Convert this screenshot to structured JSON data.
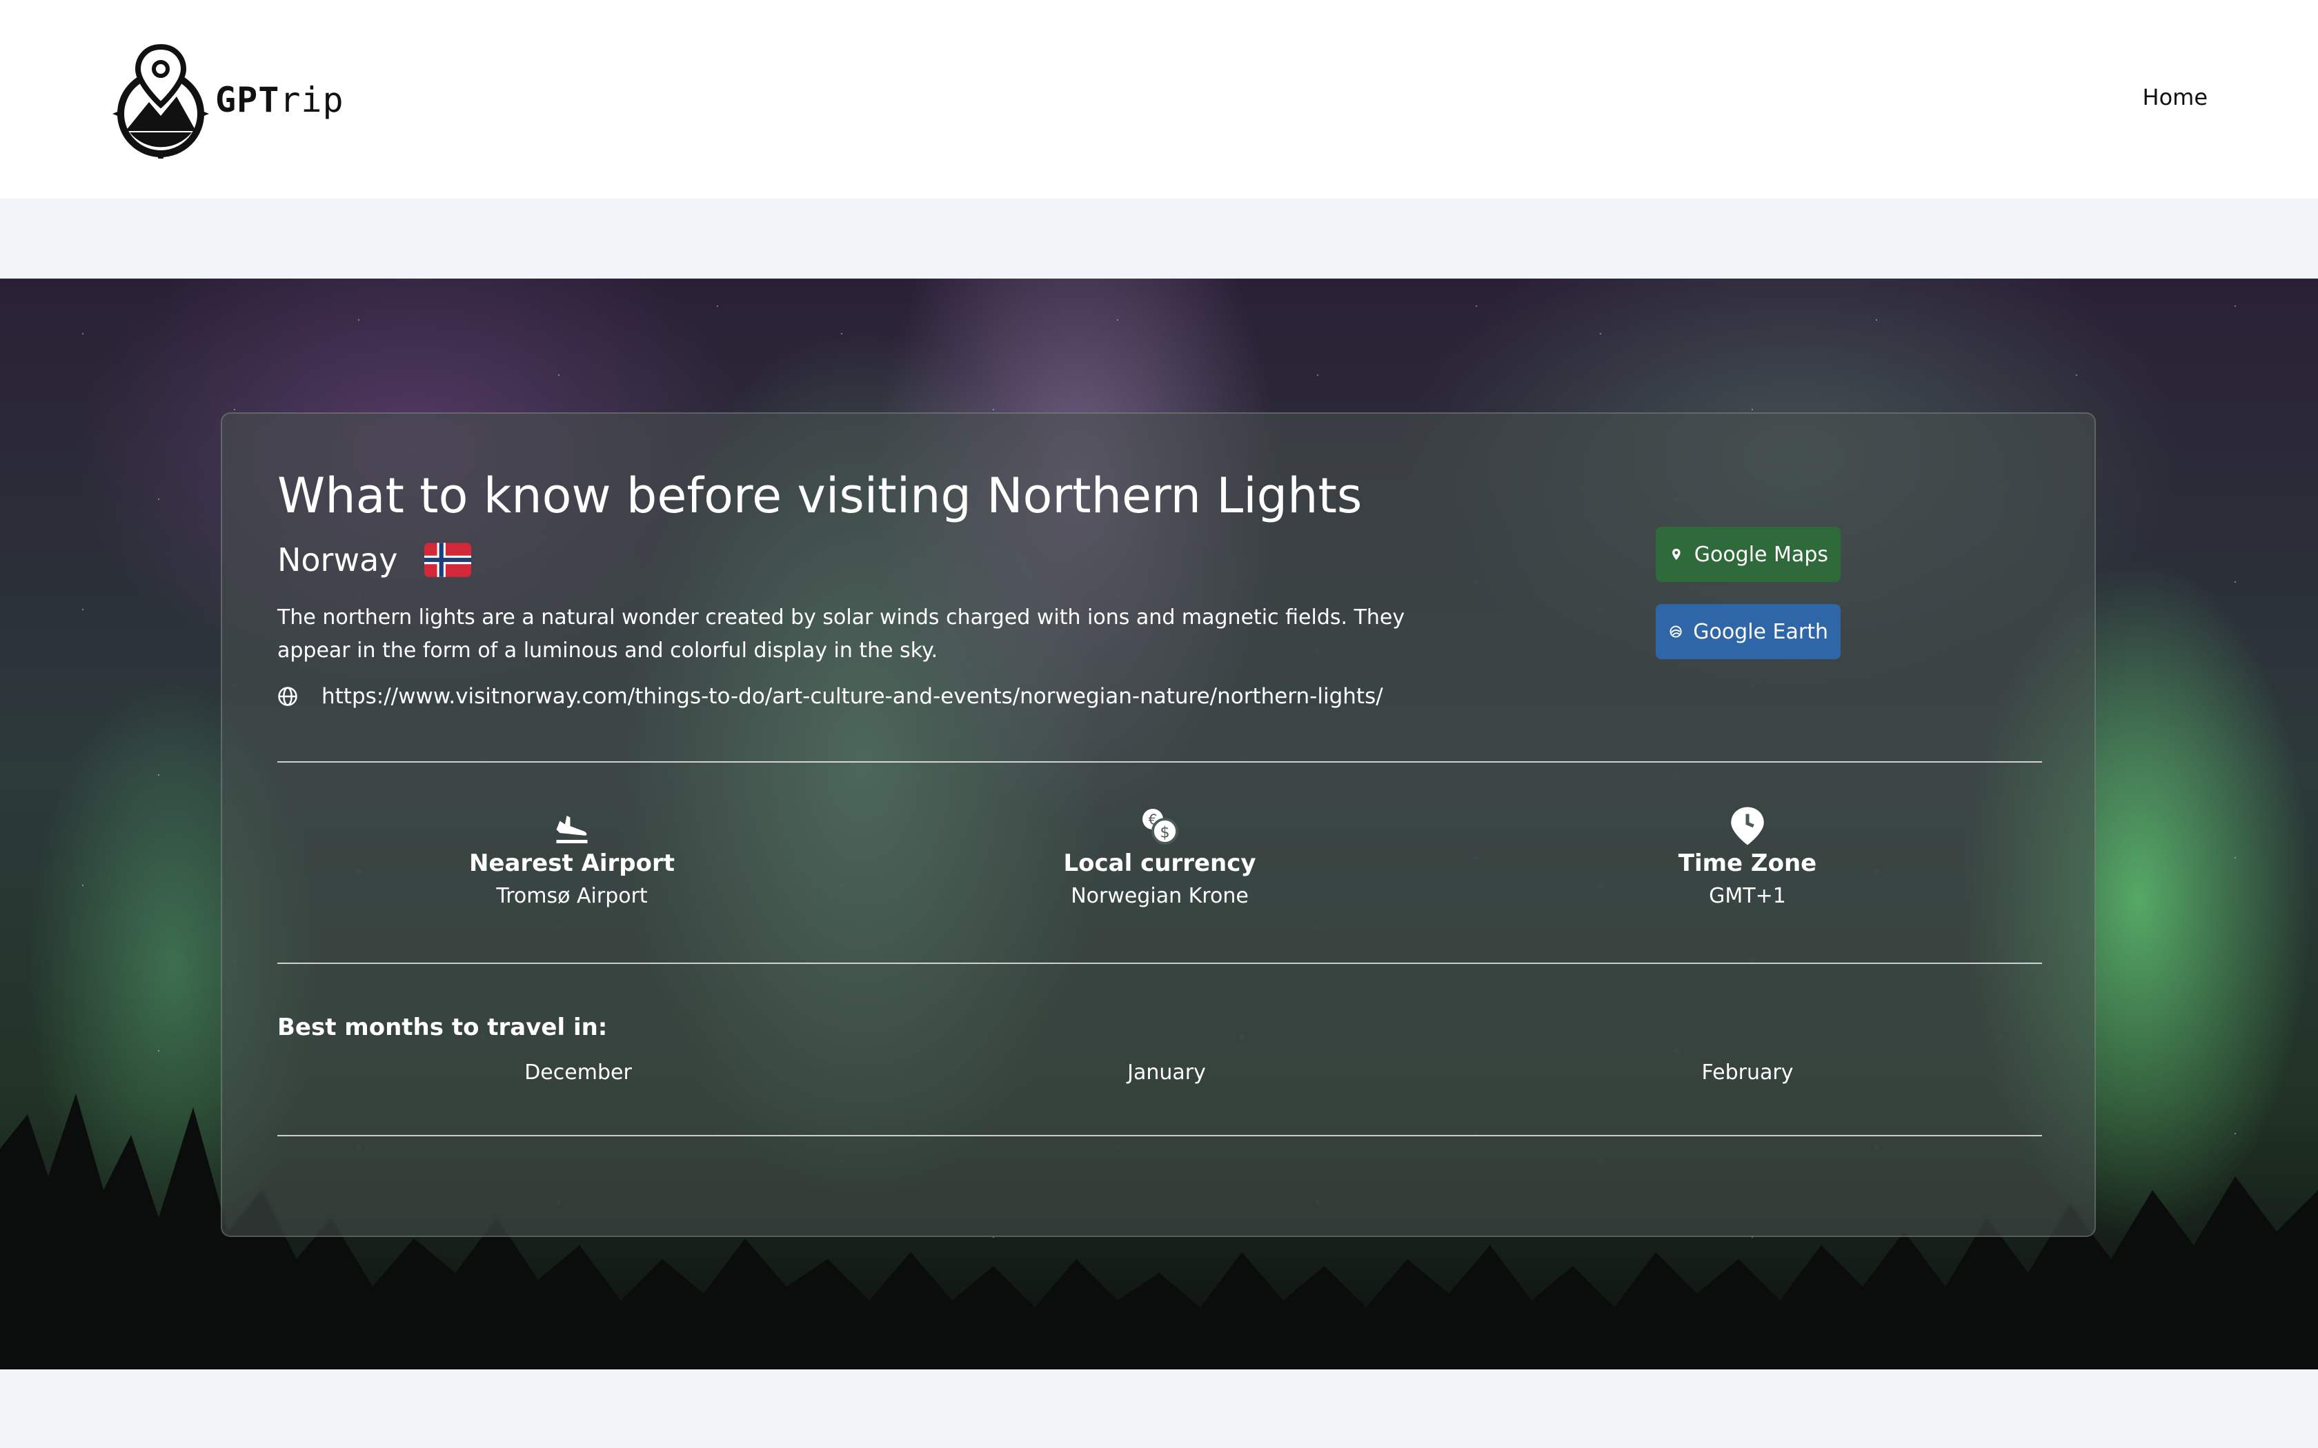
{
  "header": {
    "logo_text_bold": "GPT",
    "logo_text_rest": "rip",
    "nav": {
      "home_label": "Home"
    }
  },
  "destination": {
    "title": "What to know before visiting Northern Lights",
    "country": "Norway",
    "flag_icon": "norway-flag-icon",
    "description": "The northern lights are a natural wonder created by solar winds charged with ions and magnetic fields. They appear in the form of a luminous and colorful display in the sky.",
    "website": "https://www.visitnorway.com/things-to-do/art-culture-and-events/norwegian-nature/northern-lights/"
  },
  "actions": {
    "google_maps_label": "Google Maps",
    "google_earth_label": "Google Earth"
  },
  "info": {
    "airport": {
      "title": "Nearest Airport",
      "value": "Tromsø Airport",
      "icon": "plane-landing-icon"
    },
    "currency": {
      "title": "Local currency",
      "value": "Norwegian Krone",
      "icon": "currency-exchange-icon"
    },
    "timezone": {
      "title": "Time Zone",
      "value": "GMT+1",
      "icon": "clock-pin-icon"
    }
  },
  "best_months": {
    "heading": "Best months to travel in:",
    "months": [
      "December",
      "January",
      "February"
    ]
  },
  "colors": {
    "maps_button": "#2f6a3a",
    "earth_button": "#2f66a8",
    "page_background": "#f1f4f9"
  }
}
